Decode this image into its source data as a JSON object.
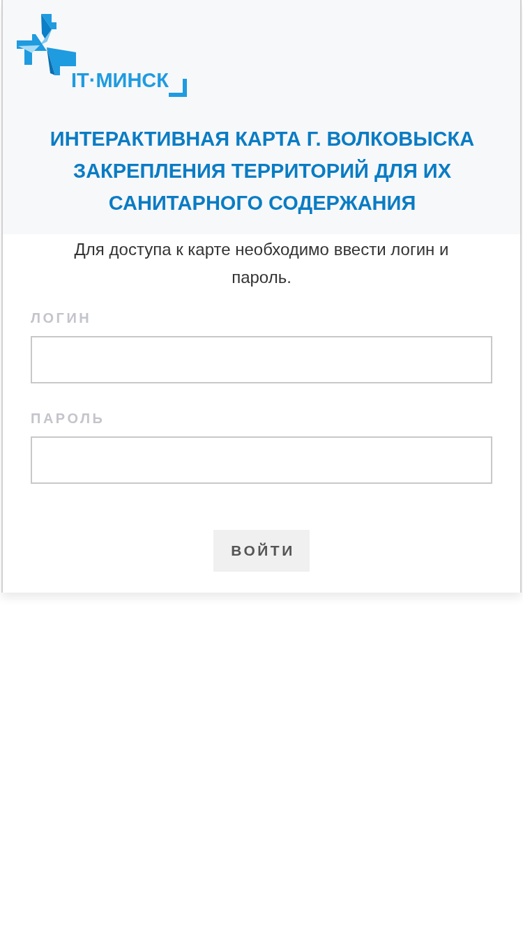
{
  "logo": {
    "text": "IT·МИНСК"
  },
  "title": "ИНТЕРАКТИВНАЯ КАРТА Г. ВОЛКОВЫСКА ЗАКРЕПЛЕНИЯ ТЕРРИТОРИЙ ДЛЯ ИХ САНИТАРНОГО СОДЕРЖАНИЯ",
  "intro": "Для доступа к карте необходимо ввести логин и пароль.",
  "fields": [
    {
      "label": "ЛОГИН"
    },
    {
      "label": "ПАРОЛЬ"
    }
  ],
  "submit": "ВОЙТИ"
}
